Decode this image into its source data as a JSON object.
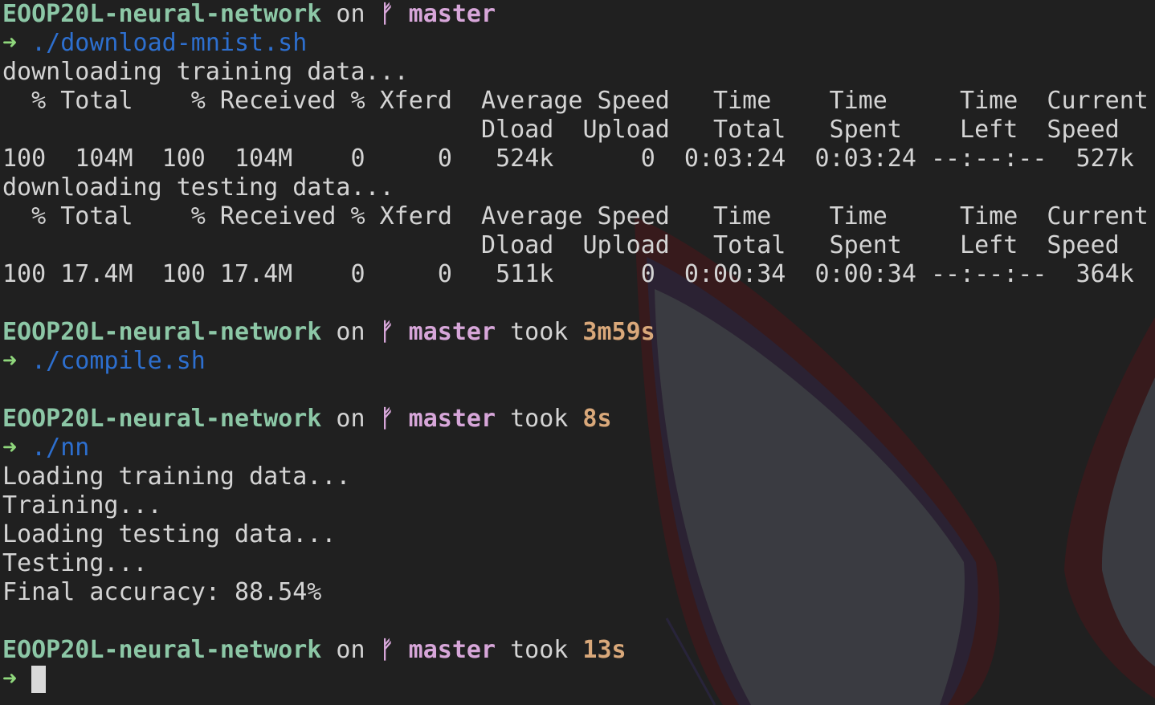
{
  "colors": {
    "background": "#202020",
    "directory": "#8cc7a6",
    "branch": "#d7a6d9",
    "duration": "#d9a87a",
    "prompt_arrow": "#8fd77c",
    "command": "#2d6fcf",
    "output": "#d4d4d4"
  },
  "icons": {
    "prompt": "arrow-right-icon",
    "branch": "git-branch-icon"
  },
  "prompt": {
    "directory": "EOOP20L-neural-network",
    "on_text": "on",
    "branch_glyph": "ᚠ",
    "branch": "master",
    "took_text": "took",
    "arrow": "➜"
  },
  "blocks": [
    {
      "took": "",
      "command": "./download-mnist.sh",
      "output": [
        "downloading training data...",
        "  % Total    % Received % Xferd  Average Speed   Time    Time     Time  Current",
        "                                 Dload  Upload   Total   Spent    Left  Speed",
        "100  104M  100  104M    0     0   524k      0  0:03:24  0:03:24 --:--:--  527k",
        "downloading testing data...",
        "  % Total    % Received % Xferd  Average Speed   Time    Time     Time  Current",
        "                                 Dload  Upload   Total   Spent    Left  Speed",
        "100 17.4M  100 17.4M    0     0   511k      0  0:00:34  0:00:34 --:--:--  364k",
        ""
      ]
    },
    {
      "took": "3m59s",
      "command": "./compile.sh",
      "output": [
        ""
      ]
    },
    {
      "took": "8s",
      "command": "./nn",
      "output": [
        "Loading training data...",
        "Training...",
        "Loading testing data...",
        "Testing...",
        "Final accuracy: 88.54%",
        ""
      ]
    }
  ],
  "final_prompt": {
    "took": "13s"
  }
}
